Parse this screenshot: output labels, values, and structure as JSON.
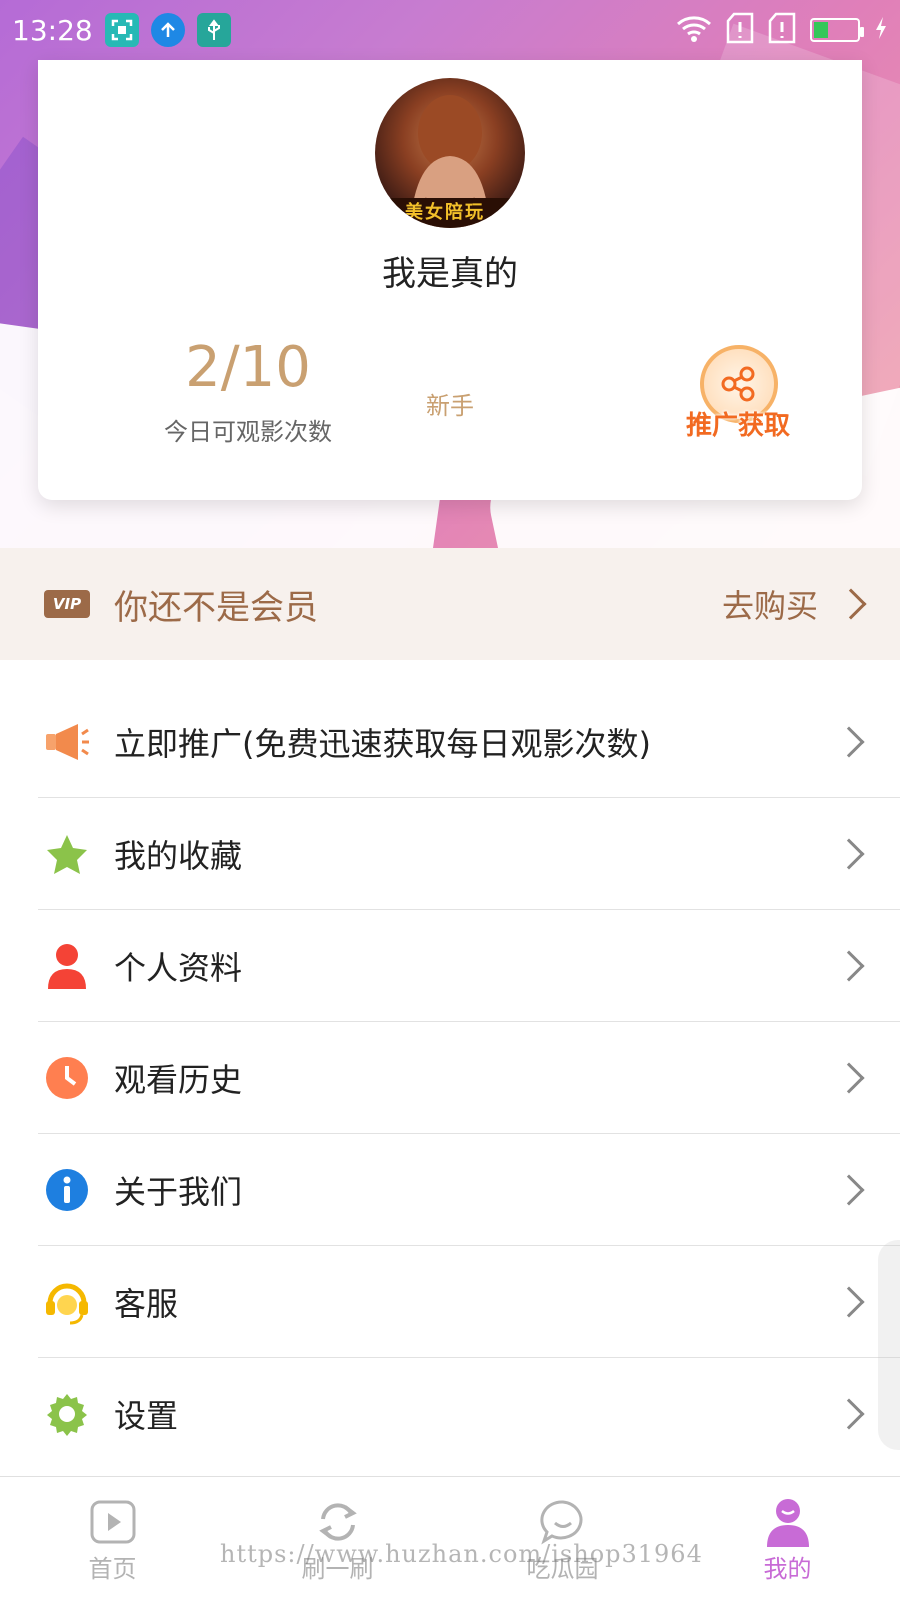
{
  "status_bar": {
    "time": "13:28"
  },
  "profile": {
    "username": "我是真的",
    "avatar_text": "美女陪玩",
    "views_count": "2/10",
    "views_label": "今日可观影次数",
    "level": "新手",
    "promo_label": "推广获取"
  },
  "vip": {
    "badge": "VIP",
    "status_text": "你还不是会员",
    "buy_label": "去购买"
  },
  "menu": {
    "items": [
      {
        "label": "立即推广(免费迅速获取每日观影次数)",
        "icon": "megaphone-icon"
      },
      {
        "label": "我的收藏",
        "icon": "star-icon"
      },
      {
        "label": "个人资料",
        "icon": "person-icon"
      },
      {
        "label": "观看历史",
        "icon": "clock-icon"
      },
      {
        "label": "关于我们",
        "icon": "info-icon"
      },
      {
        "label": "客服",
        "icon": "headset-icon"
      },
      {
        "label": "设置",
        "icon": "gear-icon"
      }
    ]
  },
  "tabs": [
    {
      "label": "首页",
      "icon": "play-icon"
    },
    {
      "label": "刷一刷",
      "icon": "refresh-icon"
    },
    {
      "label": "吃瓜园",
      "icon": "chat-icon"
    },
    {
      "label": "我的",
      "icon": "profile-icon"
    }
  ],
  "colors": {
    "accent_gold": "#c9a071",
    "vip_brown": "#9c6a48",
    "active_tab": "#c86bd6",
    "promo_orange": "#f26a21"
  },
  "watermark": "https://www.huzhan.com/ishop31964"
}
